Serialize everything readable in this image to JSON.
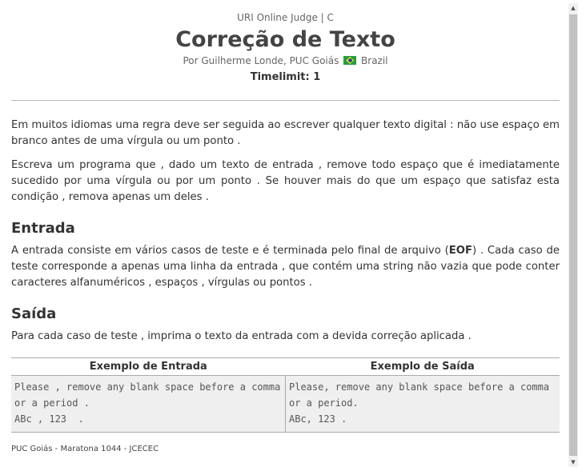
{
  "header": {
    "origin": "URI Online Judge | C",
    "title": "Correção de Texto",
    "author_prefix": "Por Guilherme Londe, PUC Goiás",
    "country": "Brazil",
    "timelimit": "Timelimit: 1"
  },
  "description": {
    "p1": "Em muitos idiomas uma regra deve ser seguida ao escrever qualquer texto digital : não use espaço em branco antes de uma vírgula ou um ponto .",
    "p2": "Escreva um programa que , dado um texto de entrada , remove todo espaço que é imediatamente sucedido por uma vírgula ou por um ponto . Se houver mais do que um espaço que satisfaz esta condição , remova apenas um deles ."
  },
  "input": {
    "heading": "Entrada",
    "text_before": "A entrada consiste em vários casos de teste e é terminada pelo final de arquivo (",
    "eof": "EOF",
    "text_after": ") . Cada caso de teste corresponde a apenas uma linha da entrada , que contém uma string não vazia que pode conter caracteres alfanuméricos , espaços , vírgulas ou pontos ."
  },
  "output": {
    "heading": "Saída",
    "text": "Para cada caso de teste , imprima o texto da entrada com a devida correção aplicada ."
  },
  "examples": {
    "input_header": "Exemplo de Entrada",
    "output_header": "Exemplo de Saída",
    "input_text": "Please , remove any blank space before a comma or a period .\nABc , 123  .",
    "output_text": "Please, remove any blank space before a comma or a period.\nABc, 123 ."
  },
  "footer": "PUC Goiás - Maratona 1044 - JCECEC",
  "colors": {
    "text": "#333333",
    "example_bg": "#efefef",
    "flag_green": "#229e45",
    "flag_yellow": "#f8e509",
    "flag_blue": "#2b49a3"
  }
}
